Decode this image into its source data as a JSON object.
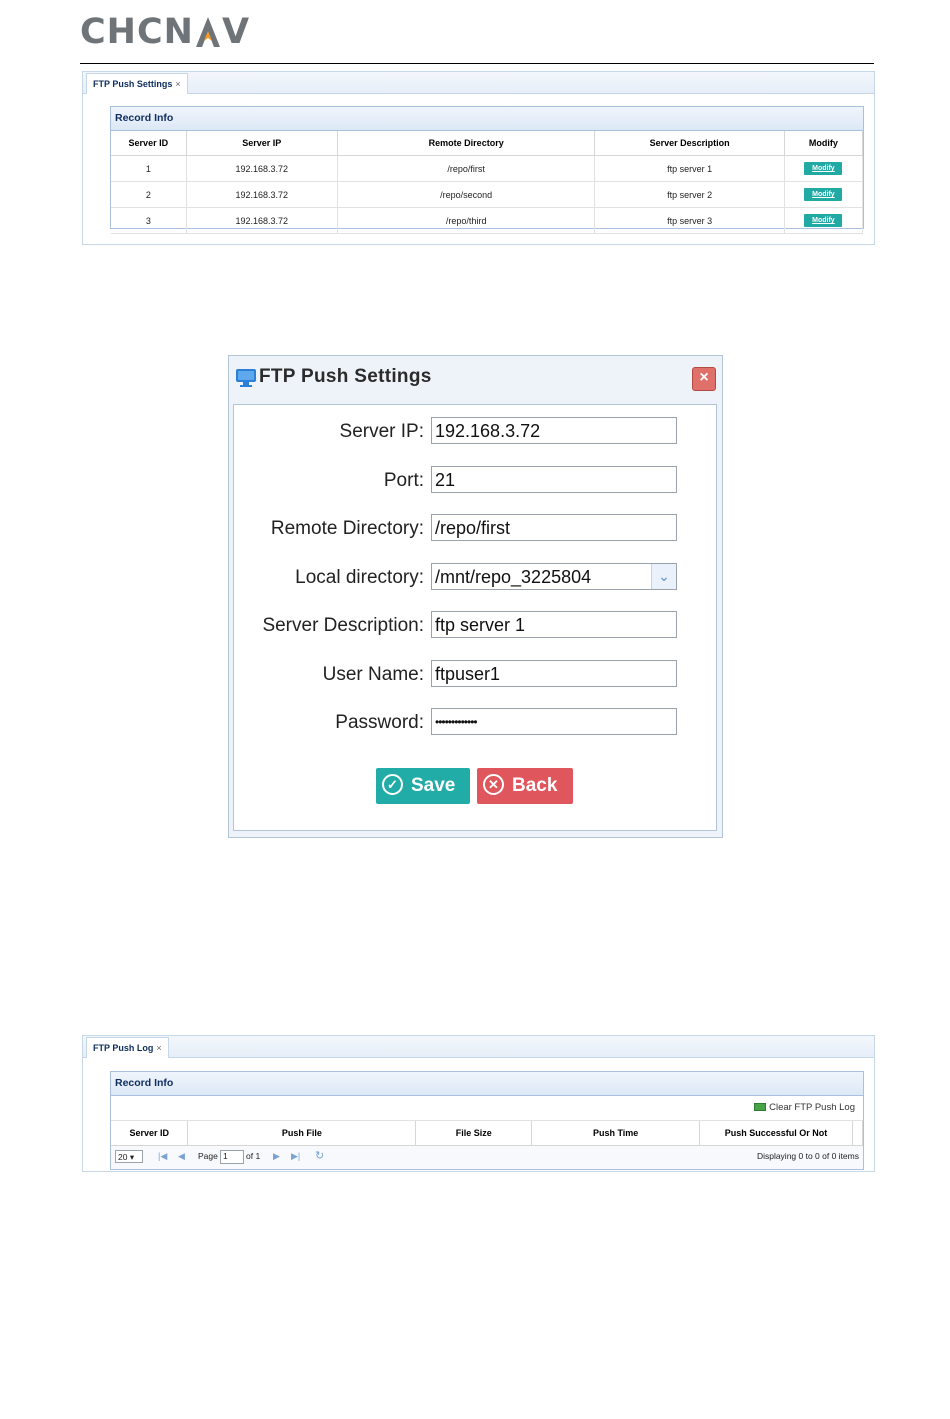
{
  "logo": {
    "text_left": "CHCN",
    "text_right": "V"
  },
  "settings_panel": {
    "tab": {
      "label": "FTP Push Settings",
      "close": "×"
    },
    "section_title": "Record Info",
    "columns": [
      "Server ID",
      "Server IP",
      "Remote Directory",
      "Server Description",
      "Modify"
    ],
    "rows": [
      {
        "id": "1",
        "ip": "192.168.3.72",
        "dir": "/repo/first",
        "desc": "ftp server 1",
        "action": "Modify"
      },
      {
        "id": "2",
        "ip": "192.168.3.72",
        "dir": "/repo/second",
        "desc": "ftp server 2",
        "action": "Modify"
      },
      {
        "id": "3",
        "ip": "192.168.3.72",
        "dir": "/repo/third",
        "desc": "ftp server 3",
        "action": "Modify"
      }
    ]
  },
  "dialog": {
    "title": "FTP Push Settings",
    "close": "×",
    "fields": {
      "server_ip": {
        "label": "Server IP:",
        "value": "192.168.3.72"
      },
      "port": {
        "label": "Port:",
        "value": "21"
      },
      "remote_dir": {
        "label": "Remote Directory:",
        "value": "/repo/first"
      },
      "local_dir": {
        "label": "Local directory:",
        "value": "/mnt/repo_3225804"
      },
      "server_desc": {
        "label": "Server Description:",
        "value": "ftp server 1"
      },
      "user_name": {
        "label": "User Name:",
        "value": "ftpuser1"
      },
      "password": {
        "label": "Password:",
        "value": "•••••••••••••"
      }
    },
    "save_label": "Save",
    "back_label": "Back"
  },
  "log_panel": {
    "tab": {
      "label": "FTP Push Log",
      "close": "×"
    },
    "section_title": "Record Info",
    "clear_label": "Clear FTP Push Log",
    "columns": [
      "Server ID",
      "Push File",
      "File Size",
      "Push Time",
      "Push Successful Or Not"
    ],
    "pager": {
      "page_size": "20",
      "page_label": "Page",
      "page_value": "1",
      "of_label": "of 1",
      "display_text": "Displaying 0 to 0 of 0 items"
    }
  }
}
